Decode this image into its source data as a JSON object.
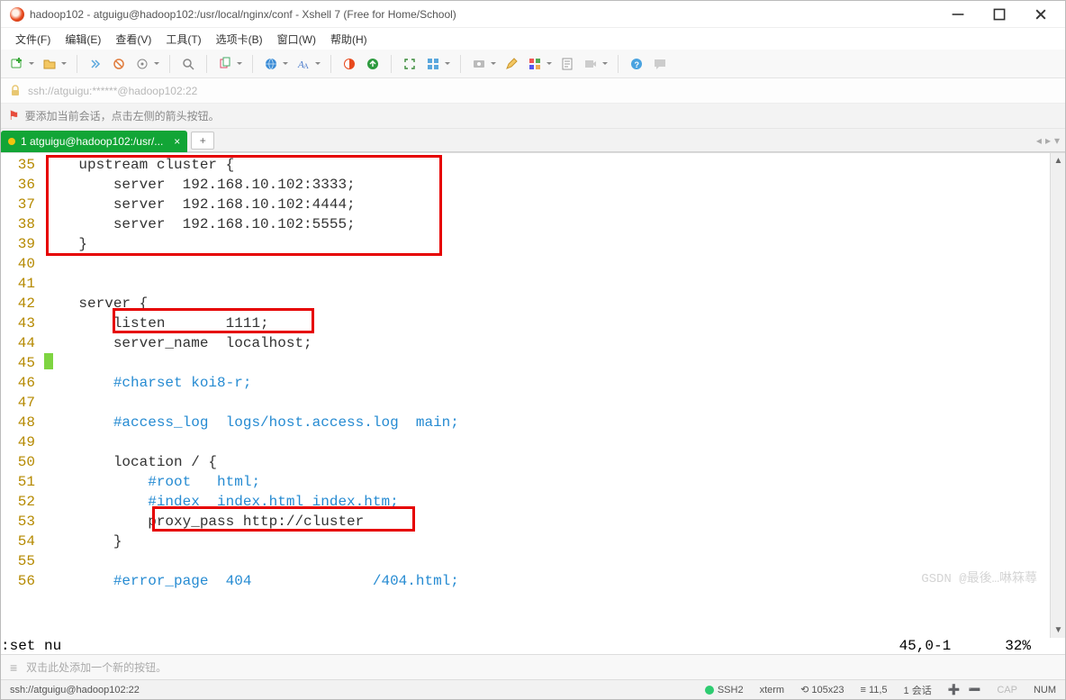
{
  "window": {
    "title": "hadoop102 - atguigu@hadoop102:/usr/local/nginx/conf - Xshell 7 (Free for Home/School)"
  },
  "menu": {
    "items": [
      "文件(F)",
      "编辑(E)",
      "查看(V)",
      "工具(T)",
      "选项卡(B)",
      "窗口(W)",
      "帮助(H)"
    ]
  },
  "address": {
    "url": "ssh://atguigu:******@hadoop102:22"
  },
  "hint": {
    "text": "要添加当前会话，点击左侧的箭头按钮。"
  },
  "tab": {
    "label": "1 atguigu@hadoop102:/usr/..."
  },
  "code": {
    "lines": [
      {
        "n": 35,
        "t": "    upstream cluster {"
      },
      {
        "n": 36,
        "t": "        server  192.168.10.102:3333;"
      },
      {
        "n": 37,
        "t": "        server  192.168.10.102:4444;"
      },
      {
        "n": 38,
        "t": "        server  192.168.10.102:5555;"
      },
      {
        "n": 39,
        "t": "    }"
      },
      {
        "n": 40,
        "t": ""
      },
      {
        "n": 41,
        "t": ""
      },
      {
        "n": 42,
        "t": "    server {"
      },
      {
        "n": 43,
        "t": "        listen       1111;"
      },
      {
        "n": 44,
        "t": "        server_name  localhost;"
      },
      {
        "n": 45,
        "t": "",
        "cursor": true
      },
      {
        "n": 46,
        "t": "        #charset koi8-r;",
        "comment": true
      },
      {
        "n": 47,
        "t": ""
      },
      {
        "n": 48,
        "t": "        #access_log  logs/host.access.log  main;",
        "comment": true
      },
      {
        "n": 49,
        "t": ""
      },
      {
        "n": 50,
        "t": "        location / {"
      },
      {
        "n": 51,
        "t": "            #root   html;",
        "comment": true
      },
      {
        "n": 52,
        "t": "            #index  index.html index.htm;",
        "comment": true
      },
      {
        "n": 53,
        "t": "            proxy_pass http://cluster"
      },
      {
        "n": 54,
        "t": "        }"
      },
      {
        "n": 55,
        "t": ""
      },
      {
        "n": 56,
        "t": "        #error_page  404              /404.html;",
        "comment": true
      }
    ]
  },
  "vim": {
    "cmd": ":set nu",
    "pos": "45,0-1",
    "pct": "32%"
  },
  "quickbar": {
    "hint": "双击此处添加一个新的按钮。"
  },
  "status": {
    "left": "ssh://atguigu@hadoop102:22",
    "proto": "SSH2",
    "term": "xterm",
    "size": "105x23",
    "cursor": "11,5",
    "sessions": "1 会话",
    "caps": "CAP",
    "num": "NUM"
  },
  "watermark": "GSDN @最後…啉箖蕁"
}
